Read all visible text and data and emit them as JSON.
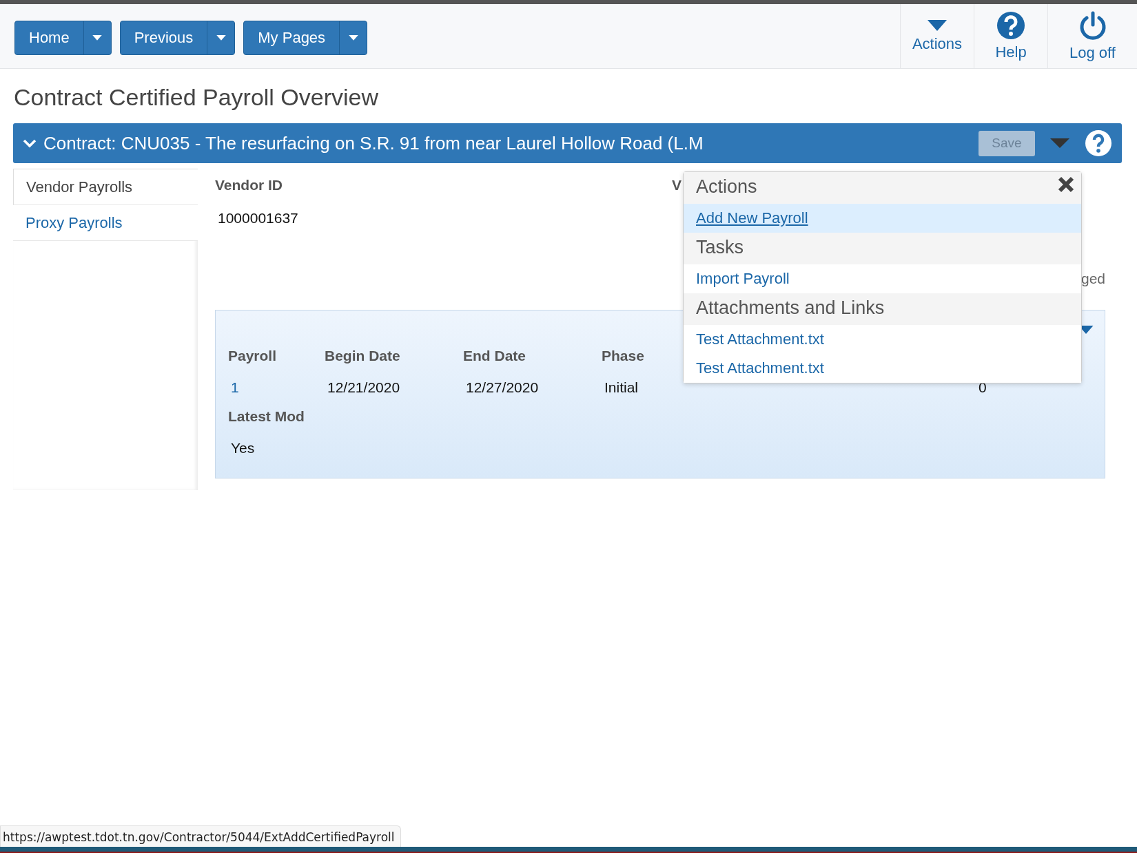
{
  "top_nav": {
    "buttons": [
      {
        "label": "Home"
      },
      {
        "label": "Previous"
      },
      {
        "label": "My Pages"
      }
    ],
    "tools": [
      {
        "kind": "caret",
        "label": "Actions"
      },
      {
        "kind": "help",
        "label": "Help"
      },
      {
        "kind": "power",
        "label": "Log off"
      }
    ]
  },
  "page_title": "Contract Certified Payroll Overview",
  "contract_bar": {
    "expanded": true,
    "title": "Contract: CNU035 - The resurfacing on S.R. 91 from near Laurel Hollow Road (L.M",
    "save": {
      "label": "Save",
      "disabled": true
    }
  },
  "sidebar": {
    "items": [
      {
        "label": "Vendor Payrolls",
        "selected": true
      },
      {
        "label": "Proxy Payrolls",
        "selected": false
      }
    ]
  },
  "vendor": {
    "label": "Vendor ID",
    "value": "1000001637",
    "column_2_label": "V",
    "column_3_text": "ged"
  },
  "table": {
    "columns": [
      "Payroll",
      "Begin Date",
      "End Date",
      "Phase"
    ],
    "rows": [
      {
        "cells": [
          "1",
          "12/21/2020",
          "12/27/2020",
          "Initial",
          "0"
        ],
        "latest_mod": "Yes"
      }
    ],
    "latest_mod_label": "Latest Mod"
  },
  "actions_menu": {
    "sections": [
      {
        "title": "Actions",
        "items": [
          {
            "label": "Add New Payroll",
            "selected": true
          }
        ]
      },
      {
        "title": "Tasks",
        "items": [
          {
            "label": "Import Payroll",
            "selected": false
          }
        ]
      },
      {
        "title": "Attachments and Links",
        "items": [
          {
            "label": "Test Attachment.txt",
            "selected": false
          },
          {
            "label": "Test Attachment.txt",
            "selected": false
          }
        ]
      }
    ]
  },
  "status_bar": {
    "url": "https://awptest.tdot.tn.gov/Contractor/5044/ExtAddCertifiedPayroll"
  }
}
